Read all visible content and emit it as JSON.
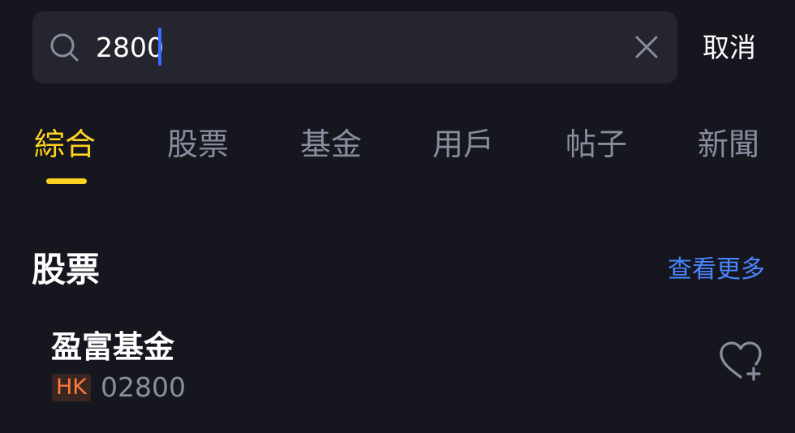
{
  "search": {
    "query": "2800",
    "cancel_label": "取消"
  },
  "tabs": [
    {
      "label": "綜合",
      "active": true
    },
    {
      "label": "股票",
      "active": false
    },
    {
      "label": "基金",
      "active": false
    },
    {
      "label": "用戶",
      "active": false
    },
    {
      "label": "帖子",
      "active": false
    },
    {
      "label": "新聞",
      "active": false
    }
  ],
  "section": {
    "title": "股票",
    "see_more_label": "查看更多"
  },
  "results": [
    {
      "name": "盈富基金",
      "market": "HK",
      "code": "02800"
    }
  ],
  "icons": {
    "search": "search-icon",
    "clear": "close-icon",
    "watch": "heart-plus-icon"
  },
  "colors": {
    "background": "#16161f",
    "search_bg": "#25252f",
    "accent": "#ffd21f",
    "link": "#4a86ff",
    "caret": "#3d6bff",
    "market_badge": "#ff7a3d",
    "muted_text": "#8a8d9e"
  }
}
